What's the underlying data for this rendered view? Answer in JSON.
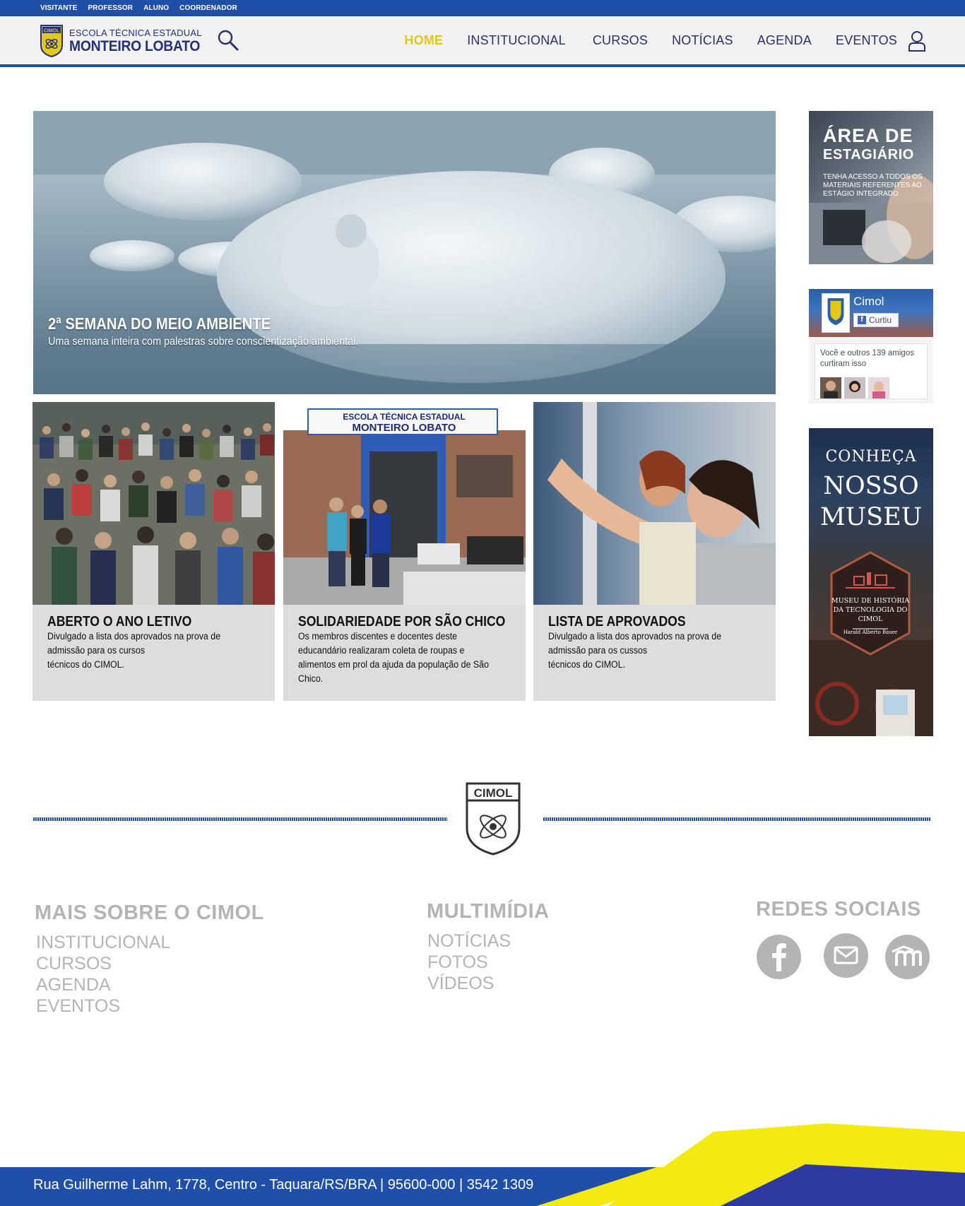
{
  "top_bar": {
    "roles": [
      "VISITANTE",
      "PROFESSOR",
      "ALUNO",
      "COORDENADOR"
    ]
  },
  "header": {
    "logo_line1": "ESCOLA TÉCNICA ESTADUAL",
    "logo_line2": "MONTEIRO LOBATO",
    "logo_badge": "CIMOL",
    "search_icon": "search-icon",
    "user_icon": "user-icon",
    "nav": [
      {
        "label": "HOME",
        "active": true
      },
      {
        "label": "INSTITUCIONAL",
        "active": false
      },
      {
        "label": "CURSOS",
        "active": false
      },
      {
        "label": "NOTÍCIAS",
        "active": false
      },
      {
        "label": "AGENDA",
        "active": false
      },
      {
        "label": "EVENTOS",
        "active": false
      }
    ]
  },
  "hero": {
    "title": "2ª SEMANA DO MEIO AMBIENTE",
    "subtitle": "Uma semana inteira com palestras sobre conscientização ambiental."
  },
  "cards": [
    {
      "title": "ABERTO O ANO LETIVO",
      "text": "Divulgado a lista dos aprovados na prova de\nadmissão para os cursos\ntécnicos do CIMOL."
    },
    {
      "title": "SOLIDARIEDADE POR SÃO CHICO",
      "text": "Os membros discentes e docentes deste educandário realizaram coleta de roupas e alimentos em prol da ajuda da população de São Chico.",
      "banner_line1": "ESCOLA TÉCNICA ESTADUAL",
      "banner_line2": "MONTEIRO LOBATO"
    },
    {
      "title": "LISTA DE APROVADOS",
      "text": "Divulgado a lista dos aprovados na prova de\nadmissão para os cussos\ntécnicos do CIMOL."
    }
  ],
  "sidebar": {
    "estagio": {
      "title1": "ÁREA DE",
      "title2": "ESTAGIÁRIO",
      "text": "TENHA ACESSO A TODOS OS MATERIAIS REFERENTES AO ESTÁGIO INTEGRADO"
    },
    "facebook": {
      "page_name": "Cimol",
      "like_label": "Curtiu",
      "friends_text": "Você e outros 139 amigos curtiram isso"
    },
    "museu": {
      "line1": "CONHEÇA",
      "line2": "NOSSO",
      "line3": "MUSEU",
      "badge_text": "MUSEU DE HISTÓRIA DA TECNOLOGIA DO CIMOL",
      "badge_name": "Harald Alberto Bauer"
    }
  },
  "divider": {
    "logo_text": "CIMOL"
  },
  "footer": {
    "col1": {
      "title": "MAIS SOBRE O CIMOL",
      "links": [
        "INSTITUCIONAL",
        "CURSOS",
        "AGENDA",
        "EVENTOS"
      ]
    },
    "col2": {
      "title": "MULTIMÍDIA",
      "links": [
        "NOTÍCIAS",
        "FOTOS",
        "VÍDEOS"
      ]
    },
    "col3": {
      "title": "REDES SOCIAIS",
      "icons": [
        "facebook-icon",
        "email-icon",
        "moodle-icon"
      ]
    },
    "address": "Rua Guilherme Lahm, 1778, Centro - Taquara/RS/BRA | 95600-000 | 3542 1309"
  },
  "colors": {
    "brand_blue": "#1f4fa8",
    "brand_navy": "#24307a",
    "active_yellow": "#e3c81a",
    "footer_gray": "#b4b4b4",
    "card_bg": "#dddddd"
  }
}
